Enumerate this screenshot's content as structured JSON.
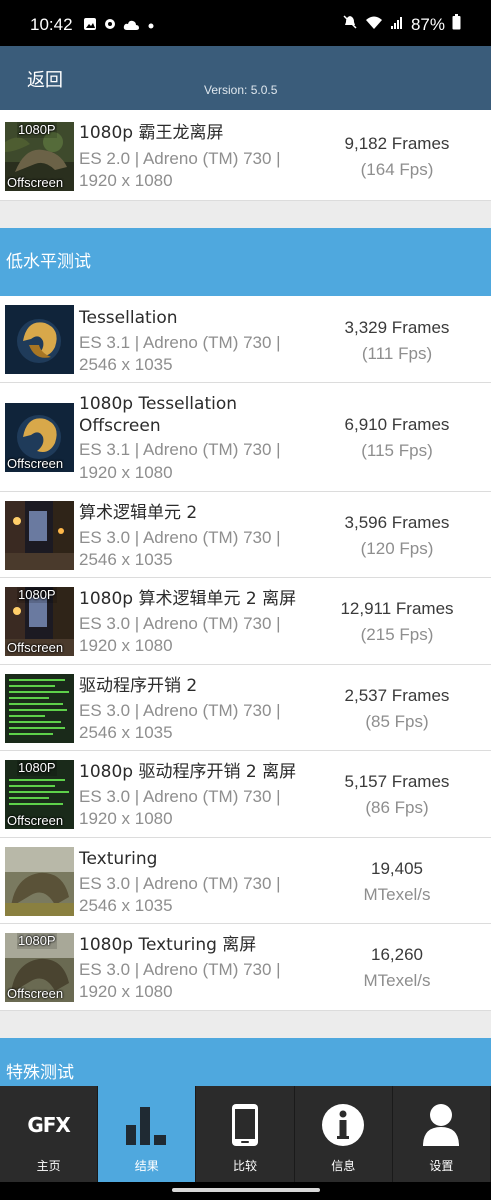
{
  "status_bar": {
    "time": "10:42",
    "battery": "87%"
  },
  "header": {
    "back_label": "返回",
    "version": "Version: 5.0.5"
  },
  "rows_top": [
    {
      "title": "1080p 霸王龙离屏",
      "api": "ES 2.0 | Adreno (TM) 730 |",
      "resolution": "1920 x 1080",
      "score": "9,182 Frames",
      "score_sub": "(164 Fps)",
      "tag_top": "1080P",
      "tag_bottom": "Offscreen"
    }
  ],
  "sections": {
    "low_level": "低水平测试",
    "special": "特殊测试"
  },
  "rows_low": [
    {
      "title": "Tessellation",
      "api": "ES 3.1 | Adreno (TM) 730 |",
      "resolution": "2546 x 1035",
      "score": "3,329 Frames",
      "score_sub": "(111 Fps)"
    },
    {
      "title": "1080p Tessellation Offscreen",
      "api": "ES 3.1 | Adreno (TM) 730 |",
      "resolution": "1920 x 1080",
      "score": "6,910 Frames",
      "score_sub": "(115 Fps)",
      "tag_bottom": "Offscreen"
    },
    {
      "title": "算术逻辑单元 2",
      "api": "ES 3.0 | Adreno (TM) 730 |",
      "resolution": "2546 x 1035",
      "score": "3,596 Frames",
      "score_sub": "(120 Fps)"
    },
    {
      "title": "1080p 算术逻辑单元 2 离屏",
      "api": "ES 3.0 | Adreno (TM) 730 |",
      "resolution": "1920 x 1080",
      "score": "12,911 Frames",
      "score_sub": "(215 Fps)",
      "tag_top": "1080P",
      "tag_bottom": "Offscreen"
    },
    {
      "title": "驱动程序开销 2",
      "api": "ES 3.0 | Adreno (TM) 730 |",
      "resolution": "2546 x 1035",
      "score": "2,537 Frames",
      "score_sub": "(85 Fps)"
    },
    {
      "title": "1080p 驱动程序开销 2 离屏",
      "api": "ES 3.0 | Adreno (TM) 730 |",
      "resolution": "1920 x 1080",
      "score": "5,157 Frames",
      "score_sub": "(86 Fps)",
      "tag_top": "1080P",
      "tag_bottom": "Offscreen"
    },
    {
      "title": "Texturing",
      "api": "ES 3.0 | Adreno (TM) 730 |",
      "resolution": "2546 x 1035",
      "score": "19,405",
      "score_sub": "MTexel/s"
    },
    {
      "title": "1080p Texturing 离屏",
      "api": "ES 3.0 | Adreno (TM) 730 |",
      "resolution": "1920 x 1080",
      "score": "16,260",
      "score_sub": "MTexel/s",
      "tag_top": "1080P",
      "tag_bottom": "Offscreen"
    }
  ],
  "bottom_nav": {
    "home": "主页",
    "results": "结果",
    "compare": "比较",
    "info": "信息",
    "settings": "设置",
    "gfx_logo": "GFX",
    "active": "results"
  },
  "colors": {
    "header_bg": "#3a5c7a",
    "section_bg": "#4fa8de",
    "nav_bg": "#2b2b2b",
    "nav_active": "#4fa8de"
  }
}
